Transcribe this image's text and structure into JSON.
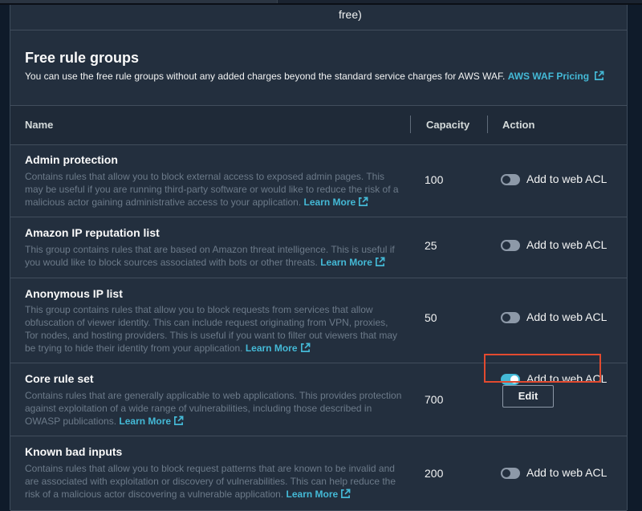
{
  "previous_section": {
    "tail_text": "free)"
  },
  "free_rule_groups": {
    "title": "Free rule groups",
    "description": "You can use the free rule groups without any added charges beyond the standard service charges for AWS WAF.",
    "pricing_link": "AWS WAF Pricing"
  },
  "table": {
    "headers": {
      "name": "Name",
      "capacity": "Capacity",
      "action": "Action"
    },
    "learn_more": "Learn More",
    "toggle_label": "Add to web ACL",
    "edit_label": "Edit",
    "rows": [
      {
        "name": "Admin protection",
        "description": "Contains rules that allow you to block external access to exposed admin pages. This may be useful if you are running third-party software or would like to reduce the risk of a malicious actor gaining administrative access to your application.",
        "capacity": "100",
        "enabled": false
      },
      {
        "name": "Amazon IP reputation list",
        "description": "This group contains rules that are based on Amazon threat intelligence. This is useful if you would like to block sources associated with bots or other threats.",
        "capacity": "25",
        "enabled": false
      },
      {
        "name": "Anonymous IP list",
        "description": "This group contains rules that allow you to block requests from services that allow obfuscation of viewer identity. This can include request originating from VPN, proxies, Tor nodes, and hosting providers. This is useful if you want to filter out viewers that may be trying to hide their identity from your application.",
        "capacity": "50",
        "enabled": false
      },
      {
        "name": "Core rule set",
        "description": "Contains rules that are generally applicable to web applications. This provides protection against exploitation of a wide range of vulnerabilities, including those described in OWASP publications.",
        "capacity": "700",
        "enabled": true
      },
      {
        "name": "Known bad inputs",
        "description": "Contains rules that allow you to block request patterns that are known to be invalid and are associated with exploitation or discovery of vulnerabilities. This can help reduce the risk of a malicious actor discovering a vulnerable application.",
        "capacity": "200",
        "enabled": false
      }
    ]
  },
  "colors": {
    "panel": "#232f3e",
    "link": "#44b9d6",
    "highlight": "#e24a2f",
    "toggle_on": "#44b9d6",
    "toggle_off": "#8d99a8"
  },
  "icons": {
    "external_link": "external-link-icon"
  }
}
